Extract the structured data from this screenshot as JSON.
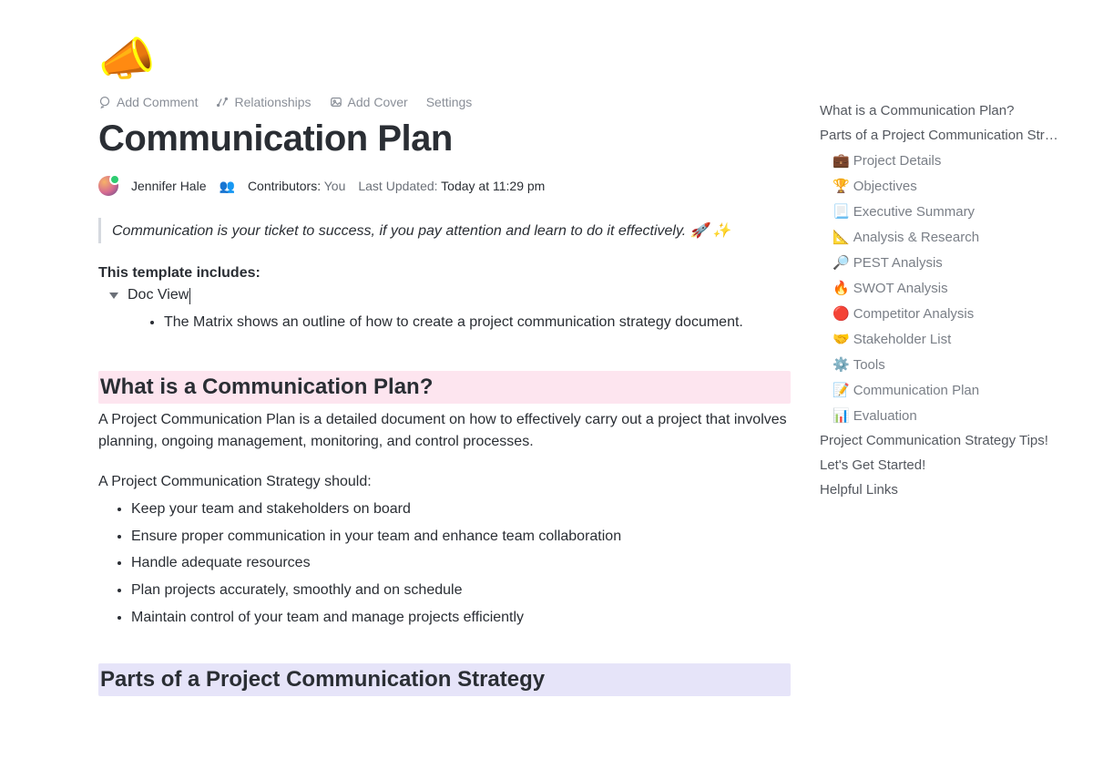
{
  "hero_icon": "📣",
  "toolbar": {
    "add_comment": "Add Comment",
    "relationships": "Relationships",
    "add_cover": "Add Cover",
    "settings": "Settings"
  },
  "title": "Communication Plan",
  "meta": {
    "author": "Jennifer Hale",
    "contributors_label": "Contributors:",
    "contributors_value": "You",
    "updated_label": "Last Updated:",
    "updated_value": "Today at 11:29 pm"
  },
  "quote": "Communication is your ticket to success, if you pay attention and learn to do it effectively. 🚀 ✨",
  "template_includes_label": "This template includes:",
  "doc_view": "Doc View",
  "doc_view_bullet": "The Matrix shows an outline of how to create a project communication strategy document.",
  "section1": {
    "heading": "What is a Communication Plan?",
    "para": "A Project Communication Plan is a detailed document on how to effectively carry out a project that involves planning, ongoing management, monitoring, and control processes.",
    "lead": "A Project Communication Strategy should:",
    "bullets": [
      "Keep your team and stakeholders on board",
      "Ensure proper communication in your team and enhance team collaboration",
      "Handle adequate resources",
      "Plan projects accurately, smoothly and on schedule",
      "Maintain control of your team and manage projects efficiently"
    ]
  },
  "section2": {
    "heading": "Parts of a Project Communication Strategy"
  },
  "outline": {
    "items": [
      "What is a Communication Plan?",
      "Parts of a Project Communication Strategy"
    ],
    "subs": [
      {
        "emoji": "💼",
        "label": "Project Details"
      },
      {
        "emoji": "🏆",
        "label": "Objectives"
      },
      {
        "emoji": "📃",
        "label": "Executive Summary"
      },
      {
        "emoji": "📐",
        "label": "Analysis & Research"
      },
      {
        "emoji": "🔎",
        "label": "PEST Analysis"
      },
      {
        "emoji": "🔥",
        "label": "SWOT Analysis"
      },
      {
        "emoji": "🔴",
        "label": "Competitor Analysis"
      },
      {
        "emoji": "🤝",
        "label": "Stakeholder List"
      },
      {
        "emoji": "⚙️",
        "label": "Tools"
      },
      {
        "emoji": "📝",
        "label": "Communication Plan"
      },
      {
        "emoji": "📊",
        "label": "Evaluation"
      }
    ],
    "tail": [
      "Project Communication Strategy Tips!",
      "Let's Get Started!",
      "Helpful Links"
    ]
  }
}
